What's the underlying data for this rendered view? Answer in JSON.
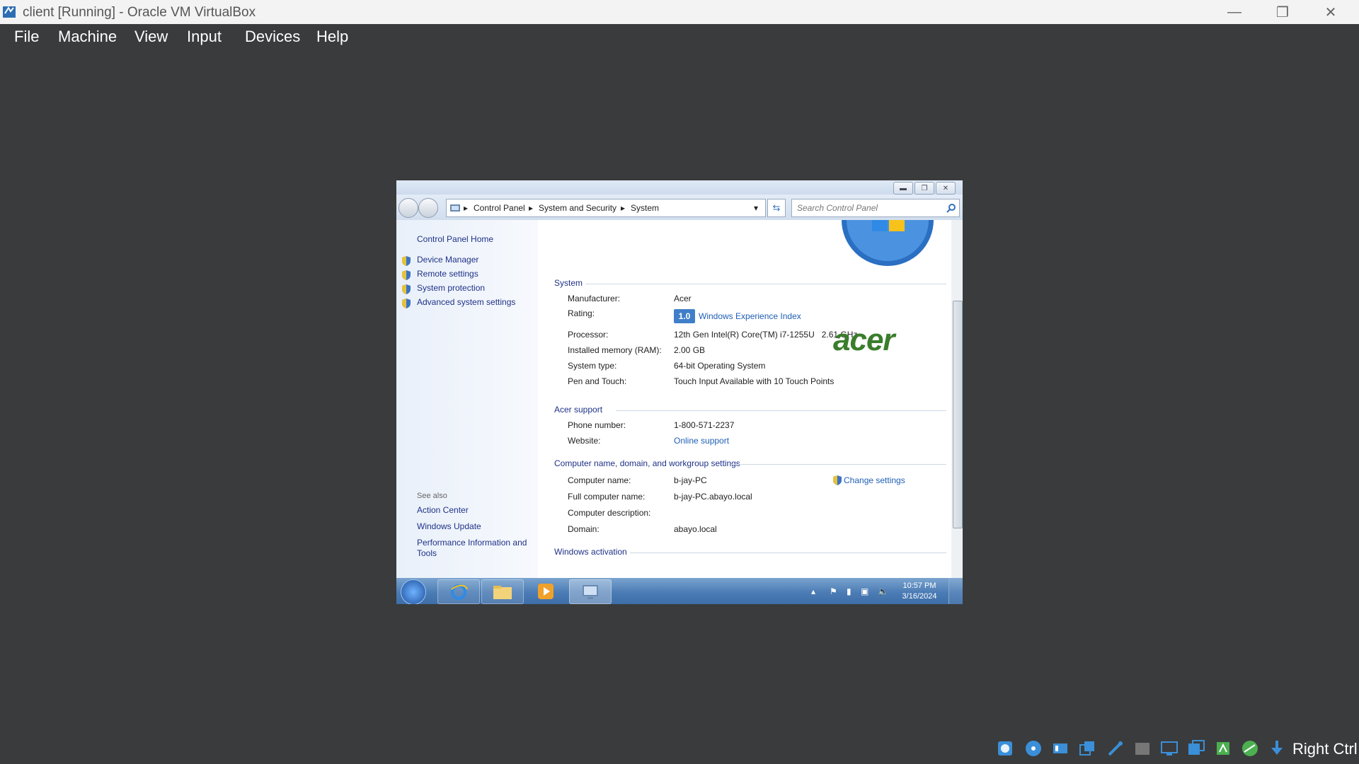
{
  "host": {
    "title": "client [Running] - Oracle VM VirtualBox",
    "menu": [
      "File",
      "Machine",
      "View",
      "Input",
      "Devices",
      "Help"
    ],
    "host_key": "Right Ctrl"
  },
  "guest": {
    "address": {
      "crumbs": [
        "Control Panel",
        "System and Security",
        "System"
      ]
    },
    "search_placeholder": "Search Control Panel",
    "sidebar": {
      "home": "Control Panel Home",
      "items": [
        "Device Manager",
        "Remote settings",
        "System protection",
        "Advanced system settings"
      ],
      "see_also_label": "See also",
      "see_also": [
        "Action Center",
        "Windows Update",
        "Performance Information and Tools"
      ]
    },
    "system": {
      "heading": "System",
      "manufacturer_label": "Manufacturer:",
      "manufacturer": "Acer",
      "rating_label": "Rating:",
      "rating_score": "1.0",
      "rating_link": "Windows Experience Index",
      "processor_label": "Processor:",
      "processor": "12th Gen Intel(R) Core(TM) i7-1255U   2.61 GHz",
      "ram_label": "Installed memory (RAM):",
      "ram": "2.00 GB",
      "type_label": "System type:",
      "type": "64-bit Operating System",
      "pen_label": "Pen and Touch:",
      "pen": "Touch Input Available with 10 Touch Points",
      "oem_logo": "acer"
    },
    "support": {
      "heading": "Acer support",
      "phone_label": "Phone number:",
      "phone": "1-800-571-2237",
      "website_label": "Website:",
      "website": "Online support"
    },
    "computer": {
      "heading": "Computer name, domain, and workgroup settings",
      "change": "Change settings",
      "name_label": "Computer name:",
      "name": "b-jay-PC",
      "full_label": "Full computer name:",
      "full": "b-jay-PC.abayo.local",
      "desc_label": "Computer description:",
      "desc": "",
      "domain_label": "Domain:",
      "domain": "abayo.local"
    },
    "activation": {
      "heading": "Windows activation"
    },
    "taskbar": {
      "time": "10:57 PM",
      "date": "3/16/2024"
    }
  },
  "colors": {
    "host_bg": "#3a3b3c",
    "link": "#1e3287",
    "taskbar": "#4c7cb5"
  }
}
